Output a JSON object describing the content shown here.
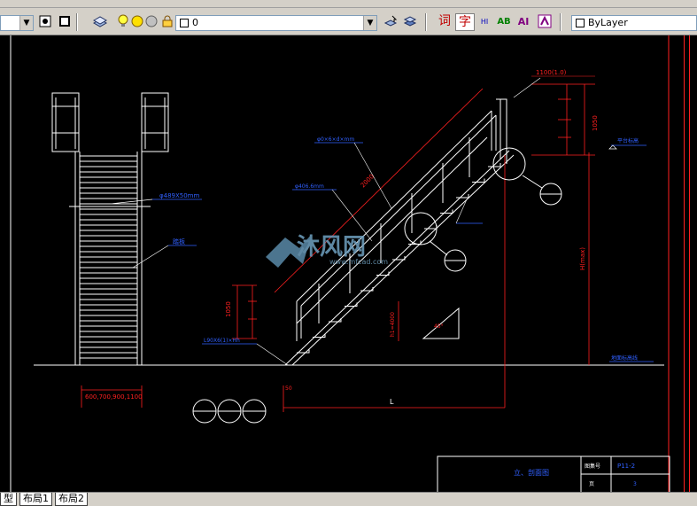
{
  "toolbar_top": {
    "icons": [
      "dropdown-arrow-icon",
      "copy-icon",
      "undo-icon",
      "redo-icon",
      "pan-icon",
      "zoom-icon",
      "text-icon",
      "table-icon",
      "layer-icon",
      "properties-icon"
    ]
  },
  "toolbar_layers": {
    "layer_value": "0",
    "linetype_value": "ByLayer",
    "text_buttons": [
      "词",
      "字",
      "HI",
      "AB",
      "AI"
    ]
  },
  "drawing": {
    "dim_left_bottom": "600,700,900,1100",
    "left_label_1": "φ489X50mm",
    "left_label_2": "踏板",
    "dim_L": "L",
    "dim_1050": "1050",
    "dim_1050_right": "1050",
    "dim_hmax": "H(max)",
    "dim_h1": "h1=4000",
    "label_top": "L100X8(1)×Hh",
    "label_mid": "φ0×6×d×mm",
    "label_pipe": "φ406.6mm",
    "label_bottom": "L90X6(1)×Hh",
    "label_right_top": "1100(1.0)",
    "label_floor_right": "平台标高",
    "label_floor_left": "地面标高线",
    "title_block_title": "立、剖面图",
    "title_block_field": "图集号",
    "title_block_code": "P11-2",
    "title_block_page_label": "页",
    "title_block_page": "3",
    "watermark_text": "沐风网",
    "watermark_url": "www.mfcad.com"
  },
  "tabs": [
    "型",
    "布局1",
    "布局2"
  ],
  "colors": {
    "bg": "#000000",
    "white": "#ffffff",
    "red": "#ff2020",
    "blue": "#3060ff",
    "cyan": "#00c0c0",
    "toolbar": "#d4d0c8"
  }
}
